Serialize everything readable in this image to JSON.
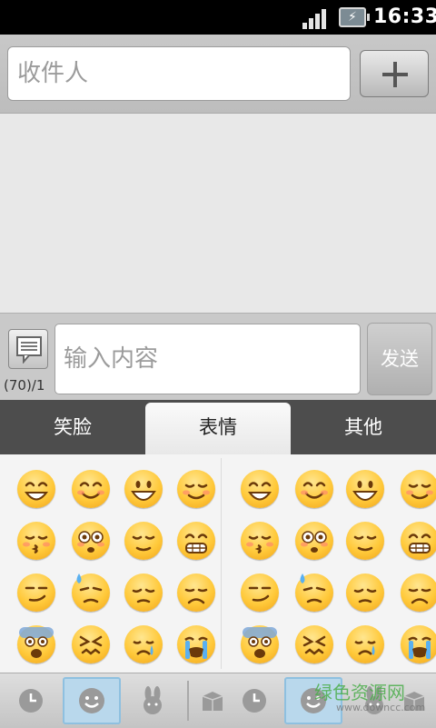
{
  "status_bar": {
    "time": "16:33",
    "signal_icon": "signal-bars-icon",
    "battery_icon": "battery-charging-icon"
  },
  "recipient": {
    "placeholder": "收件人",
    "add_icon": "plus-icon"
  },
  "compose": {
    "counter": "(70)/1",
    "placeholder": "输入内容",
    "send_label": "发送",
    "template_icon": "message-template-icon"
  },
  "tabs": [
    {
      "label": "笑脸",
      "selected": false
    },
    {
      "label": "表情",
      "selected": true
    },
    {
      "label": "其他",
      "selected": false
    }
  ],
  "emoji_grid": {
    "rows": [
      [
        "grin",
        "smile",
        "big-grin",
        "blush",
        "grin",
        "smile",
        "big-grin",
        "blush"
      ],
      [
        "kiss",
        "flushed",
        "relieved",
        "grimace",
        "kiss",
        "flushed",
        "relieved",
        "grimace"
      ],
      [
        "smirk",
        "sweat",
        "pensive",
        "disappointed",
        "smirk",
        "sweat",
        "pensive",
        "disappointed"
      ],
      [
        "fearful",
        "confounded",
        "cry",
        "sob",
        "fearful",
        "confounded",
        "cry",
        "sob"
      ]
    ]
  },
  "bottom_bar": {
    "items": [
      {
        "icon": "recent-clock-icon",
        "selected": false
      },
      {
        "icon": "smiley-face-icon",
        "selected": true
      },
      {
        "icon": "bunny-icon",
        "selected": false
      },
      {
        "icon": "gift-box-icon",
        "selected": false
      },
      {
        "icon": "recent-clock-icon",
        "selected": false
      },
      {
        "icon": "smiley-face-icon",
        "selected": true
      },
      {
        "icon": "bunny-icon",
        "selected": false
      },
      {
        "icon": "gift-box-icon",
        "selected": false
      }
    ]
  },
  "watermark": {
    "text": "绿色资源网",
    "sub": "www.downcc.com"
  },
  "colors": {
    "tab_bar": "#4d4d4d",
    "selected_tab": "#f2f2f2",
    "emoji_yellow": "#ffc93a",
    "selected_highlight": "#b9d8ec"
  }
}
